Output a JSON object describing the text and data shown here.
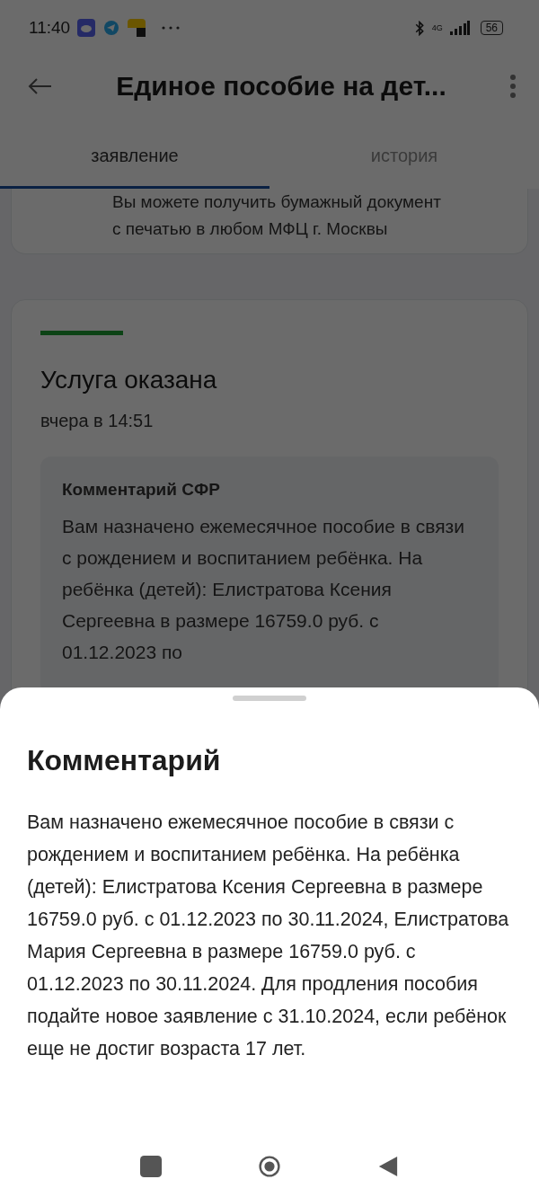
{
  "status_bar": {
    "time": "11:40",
    "network": "4G",
    "battery": "56"
  },
  "header": {
    "title": "Единое пособие на дет..."
  },
  "tabs": [
    {
      "label": "заявление",
      "selected": true
    },
    {
      "label": "история",
      "selected": false
    }
  ],
  "info_card": {
    "lines": [
      "Вы можете получить бумажный документ",
      "с печатью в любом МФЦ г. Москвы"
    ]
  },
  "status_card": {
    "status": "Услуга оказана",
    "time": "вчера в 14:51",
    "comment": {
      "title": "Комментарий СФР",
      "text": "Вам назначено ежемесячное пособие в связи с рождением и воспитанием ребёнка. На ребёнка (детей): Елистратова Ксения Сергеевна в размере 16759.0 руб. с 01.12.2023 по"
    }
  },
  "sheet": {
    "title": "Комментарий",
    "text": "Вам назначено ежемесячное пособие в связи с рождением и воспитанием ребёнка. На ребёнка (детей): Елистратова Ксения Сергеевна в размере 16759.0 руб. с 01.12.2023 по 30.11.2024, Елистратова Мария Сергеевна в размере 16759.0 руб. с 01.12.2023 по 30.11.2024. Для продления пособия подайте новое заявление с 31.10.2024, если ребёнок еще не достиг возраста 17 лет."
  }
}
